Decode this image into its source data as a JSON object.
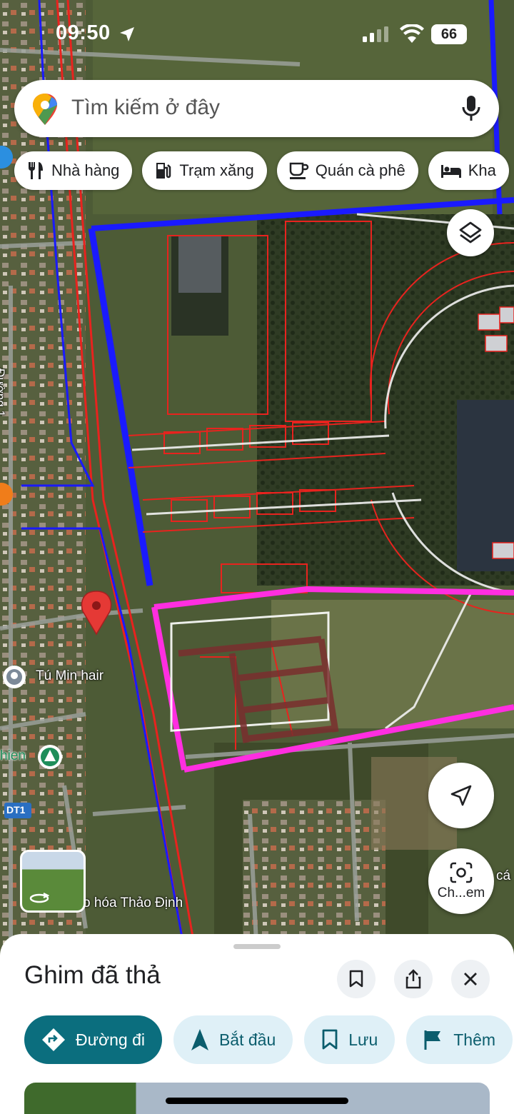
{
  "status_bar": {
    "time": "09:50",
    "battery": "66"
  },
  "search": {
    "placeholder": "Tìm kiếm ở đây"
  },
  "chips": [
    {
      "label": "Nhà hàng",
      "icon": "restaurant-icon"
    },
    {
      "label": "Trạm xăng",
      "icon": "gas-station-icon"
    },
    {
      "label": "Quán cà phê",
      "icon": "coffee-icon"
    },
    {
      "label": "Kha",
      "icon": "hotel-icon"
    }
  ],
  "map": {
    "labels": {
      "tu_min_hair": "Tú Min hair",
      "thao_dinh": "o hóa Thảo Định",
      "duong1": "Đường 1",
      "dt1": "DT1",
      "nhien": "hien",
      "edge_text": "cá"
    },
    "colors": {
      "plan_red": "#e8231e",
      "boundary_blue": "#1a1aff",
      "magenta": "#ff2ee0",
      "pin_red": "#e53935"
    }
  },
  "lens": {
    "label": "Ch...em"
  },
  "sheet": {
    "title": "Ghim đã thả",
    "actions": [
      {
        "label": "Đường đi",
        "icon": "directions-icon"
      },
      {
        "label": "Bắt đầu",
        "icon": "navigation-arrow-icon"
      },
      {
        "label": "Lưu",
        "icon": "bookmark-icon"
      },
      {
        "label": "Thêm",
        "icon": "flag-icon"
      }
    ]
  }
}
